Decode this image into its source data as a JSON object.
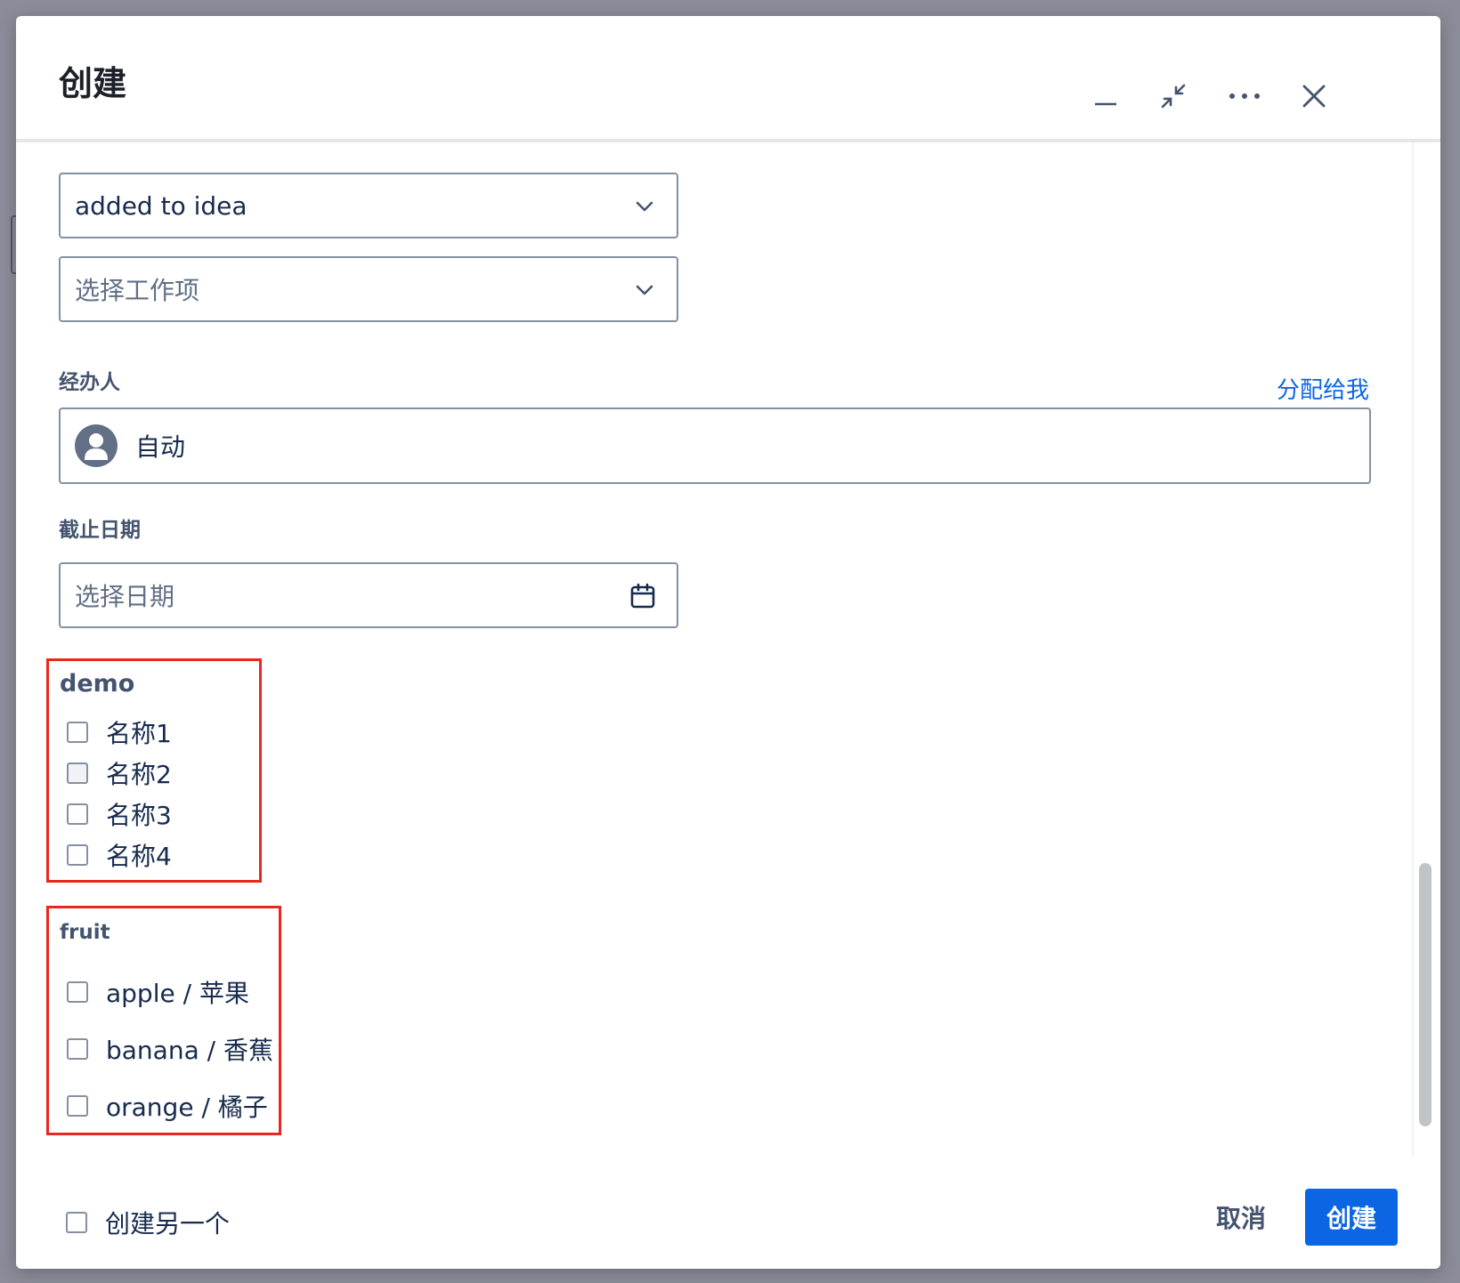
{
  "modal": {
    "title": "创建",
    "header_icons": [
      "minimize-icon",
      "collapse-icon",
      "more-icon",
      "close-icon"
    ]
  },
  "fields": {
    "status_select": {
      "value": "added to idea"
    },
    "work_item_select": {
      "placeholder": "选择工作项"
    },
    "assignee": {
      "label": "经办人",
      "assign_to_me": "分配给我",
      "value": "自动"
    },
    "due_date": {
      "label": "截止日期",
      "placeholder": "选择日期"
    }
  },
  "groups": {
    "demo": {
      "title": "demo",
      "options": [
        {
          "label": "名称1",
          "checked": false
        },
        {
          "label": "名称2",
          "checked": false
        },
        {
          "label": "名称3",
          "checked": false
        },
        {
          "label": "名称4",
          "checked": false
        }
      ]
    },
    "fruit": {
      "title": "fruit",
      "options": [
        {
          "label": "apple / 苹果",
          "checked": false
        },
        {
          "label": "banana / 香蕉",
          "checked": false
        },
        {
          "label": "orange / 橘子",
          "checked": false
        }
      ]
    }
  },
  "footer": {
    "create_another": "创建另一个",
    "cancel": "取消",
    "create": "创建"
  },
  "colors": {
    "primary": "#0c66e4",
    "highlight_border": "#e8271e",
    "field_border": "#8590a2",
    "overlay": "#8b8e9a"
  }
}
